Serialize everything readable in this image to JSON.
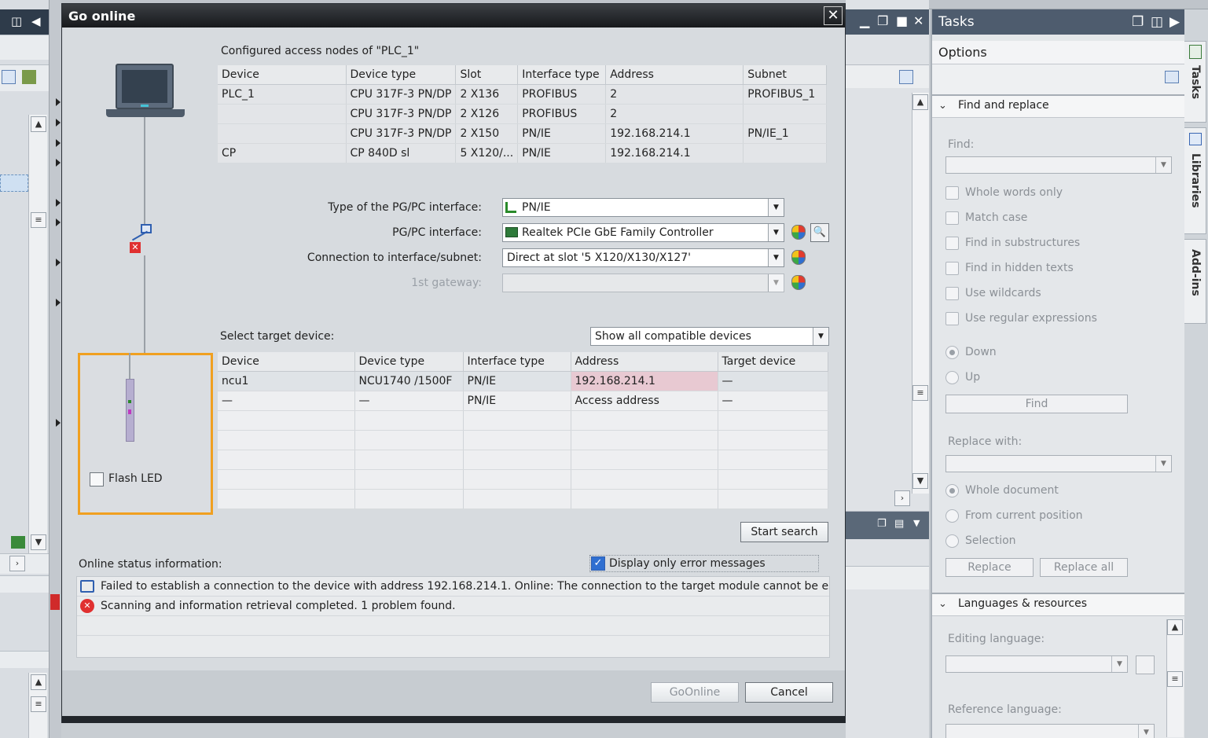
{
  "dialog": {
    "title": "Go online",
    "close_glyph": "✕"
  },
  "nodes": {
    "heading": "Configured access nodes of \"PLC_1\"",
    "columns": [
      "Device",
      "Device type",
      "Slot",
      "Interface type",
      "Address",
      "Subnet"
    ],
    "rows": [
      [
        "PLC_1",
        "CPU 317F-3 PN/DP",
        "2 X136",
        "PROFIBUS",
        "2",
        "PROFIBUS_1"
      ],
      [
        "",
        "CPU 317F-3 PN/DP",
        "2 X126",
        "PROFIBUS",
        "2",
        ""
      ],
      [
        "",
        "CPU 317F-3 PN/DP",
        "2 X150",
        "PN/IE",
        "192.168.214.1",
        "PN/IE_1"
      ],
      [
        "CP",
        "CP 840D sl",
        "5 X120/...",
        "PN/IE",
        "192.168.214.1",
        ""
      ]
    ]
  },
  "interface": {
    "type_label": "Type of the PG/PC interface:",
    "type_value": "PN/IE",
    "pgpc_label": "PG/PC interface:",
    "pgpc_value": "Realtek PCIe GbE Family Controller",
    "conn_label": "Connection to interface/subnet:",
    "conn_value": "Direct at slot '5 X120/X130/X127'",
    "gateway_label": "1st gateway:",
    "gateway_value": ""
  },
  "target": {
    "heading": "Select target device:",
    "filter_value": "Show all compatible devices",
    "columns": [
      "Device",
      "Device type",
      "Interface type",
      "Address",
      "Target device"
    ],
    "rows": [
      [
        "ncu1",
        "NCU1740 /1500F",
        "PN/IE",
        "192.168.214.1",
        "—"
      ],
      [
        "—",
        "—",
        "PN/IE",
        "Access address",
        "—"
      ]
    ]
  },
  "flash_led_label": "Flash LED",
  "start_search_label": "Start search",
  "status": {
    "heading": "Online status information:",
    "display_errors_label": "Display only error messages",
    "display_errors_checked": true,
    "messages": [
      {
        "icon": "network-error-icon",
        "text": "Failed to establish a connection to the device with address 192.168.214.1. Online: The connection to the target module cannot be estab"
      },
      {
        "icon": "error-circle-icon",
        "text": "Scanning and information retrieval completed. 1 problem found."
      }
    ]
  },
  "footer": {
    "go_online_label": "GoOnline",
    "cancel_label": "Cancel"
  },
  "tasks": {
    "title": "Tasks",
    "options_label": "Options",
    "find_replace": {
      "heading": "Find and replace",
      "find_label": "Find:",
      "checkboxes": [
        "Whole words only",
        "Match case",
        "Find in substructures",
        "Find in hidden texts",
        "Use wildcards",
        "Use regular expressions"
      ],
      "direction": [
        "Down",
        "Up"
      ],
      "find_button": "Find",
      "replace_label": "Replace with:",
      "scope": [
        "Whole document",
        "From current position",
        "Selection"
      ],
      "replace_button": "Replace",
      "replace_all_button": "Replace all"
    },
    "languages": {
      "heading": "Languages & resources",
      "editing_label": "Editing language:",
      "reference_label": "Reference language:"
    }
  },
  "side_tabs": [
    "Tasks",
    "Libraries",
    "Add-ins"
  ],
  "colors": {
    "highlight_border": "#f0a020",
    "address_highlight": "#e8c9d2",
    "error_red": "#e03030"
  }
}
